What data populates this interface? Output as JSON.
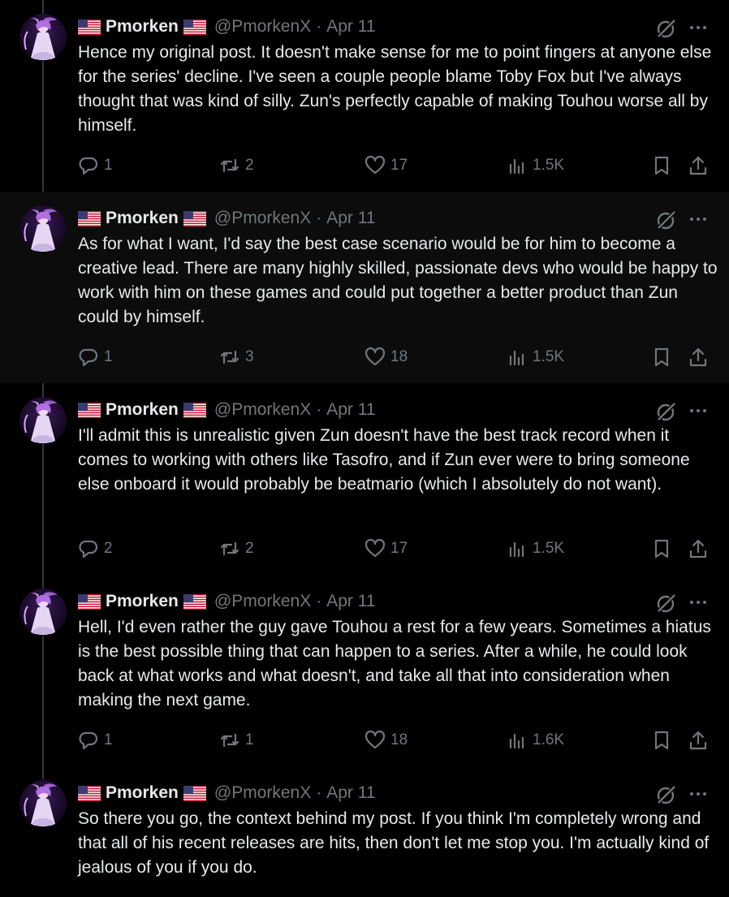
{
  "author": {
    "name": "Pmorken",
    "handle": "@PmorkenX",
    "separator": "·"
  },
  "colors": {
    "background": "#000000",
    "text": "#e7e9ea",
    "muted": "#71767b",
    "thread_line": "#333639"
  },
  "icons": [
    "us-flag-icon",
    "grok-icon",
    "more-icon",
    "reply-icon",
    "retweet-icon",
    "like-icon",
    "views-icon",
    "bookmark-icon",
    "share-icon"
  ],
  "tweets": [
    {
      "date": "Apr 11",
      "text": "Hence my original post. It doesn't make sense for me to point fingers at anyone else for the series' decline. I've seen a couple people blame Toby Fox but I've always thought that was kind of silly. Zun's perfectly capable of making Touhou worse all by himself.",
      "replies": "1",
      "retweets": "2",
      "likes": "17",
      "views": "1.5K"
    },
    {
      "date": "Apr 11",
      "text": "As for what I want, I'd say the best case scenario would be for him to become a creative lead. There are many highly skilled, passionate devs who would be happy to work with him on these games and could put together a better product than Zun could by himself.",
      "replies": "1",
      "retweets": "3",
      "likes": "18",
      "views": "1.5K"
    },
    {
      "date": "Apr 11",
      "text": "I'll admit this is unrealistic given Zun doesn't have the best track record when it comes to working with others like Tasofro, and if Zun ever were to bring someone else onboard it would probably be beatmario (which I absolutely do not want).",
      "replies": "2",
      "retweets": "2",
      "likes": "17",
      "views": "1.5K"
    },
    {
      "date": "Apr 11",
      "text": "Hell, I'd even rather the guy gave Touhou a rest for a few years. Sometimes a hiatus is the best possible thing that can happen to a series. After a while, he could look back at what works and what doesn't, and take all that into consideration when making the next game.",
      "replies": "1",
      "retweets": "1",
      "likes": "18",
      "views": "1.6K"
    },
    {
      "date": "Apr 11",
      "text": "So there you go, the context behind my post. If you think I'm completely wrong and that all of his recent releases are hits, then don't let me stop you. I'm actually kind of jealous of you if you do."
    }
  ]
}
